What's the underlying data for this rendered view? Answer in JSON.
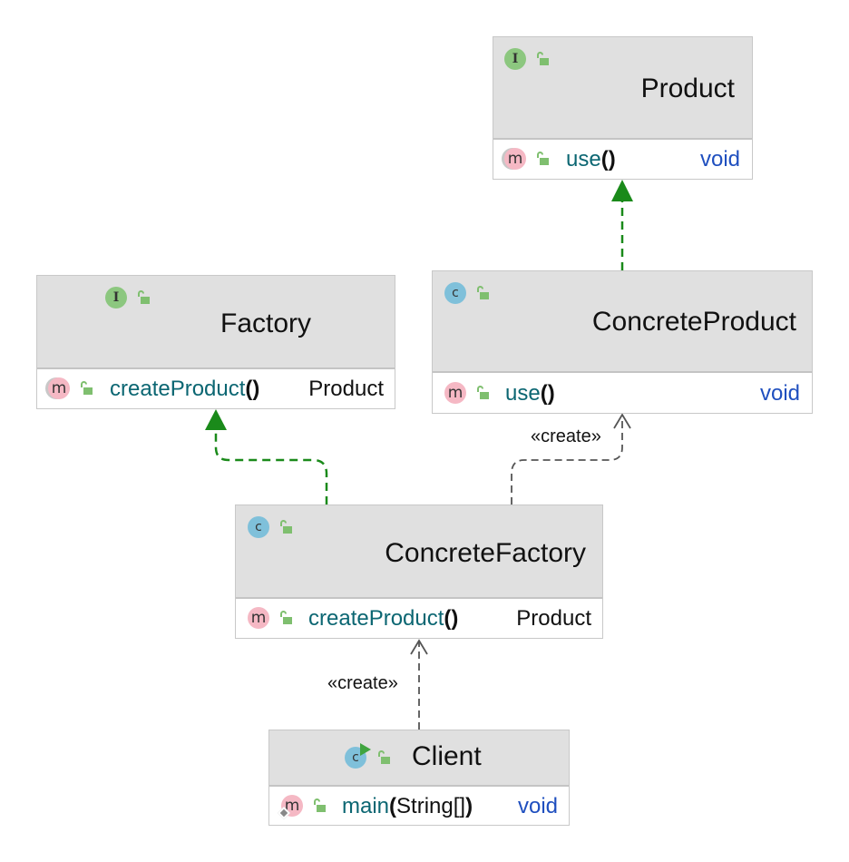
{
  "diagram": {
    "nodes": {
      "product": {
        "name": "Product",
        "kind": "interface",
        "kind_letter": "I",
        "methods": [
          {
            "name": "use",
            "params": "",
            "return_type": "void"
          }
        ]
      },
      "factory": {
        "name": "Factory",
        "kind": "interface",
        "kind_letter": "I",
        "methods": [
          {
            "name": "createProduct",
            "params": "",
            "return_type": "Product"
          }
        ]
      },
      "concrete_product": {
        "name": "ConcreteProduct",
        "kind": "class",
        "kind_letter": "c",
        "methods": [
          {
            "name": "use",
            "params": "",
            "return_type": "void"
          }
        ]
      },
      "concrete_factory": {
        "name": "ConcreteFactory",
        "kind": "class",
        "kind_letter": "c",
        "methods": [
          {
            "name": "createProduct",
            "params": "",
            "return_type": "Product"
          }
        ]
      },
      "client": {
        "name": "Client",
        "kind": "runnable-class",
        "kind_letter": "c",
        "methods": [
          {
            "name": "main",
            "params": "String[]",
            "return_type": "void",
            "static": true
          }
        ]
      }
    },
    "edges": [
      {
        "from": "concrete_product",
        "to": "product",
        "type": "realization",
        "label": ""
      },
      {
        "from": "concrete_factory",
        "to": "factory",
        "type": "realization",
        "label": ""
      },
      {
        "from": "concrete_factory",
        "to": "concrete_product",
        "type": "dependency",
        "label": "«create»"
      },
      {
        "from": "client",
        "to": "concrete_factory",
        "type": "dependency",
        "label": "«create»"
      }
    ],
    "colors": {
      "realization": "#1a8a1a",
      "dependency": "#555555",
      "header_bg": "#e0e0e0",
      "method_name": "#0b6672",
      "void_type": "#1f4fbf",
      "interface_icon": "#8cc77f",
      "class_icon": "#7fc0da",
      "method_icon": "#f5b8c4",
      "lock_icon": "#7fbf6f"
    }
  }
}
